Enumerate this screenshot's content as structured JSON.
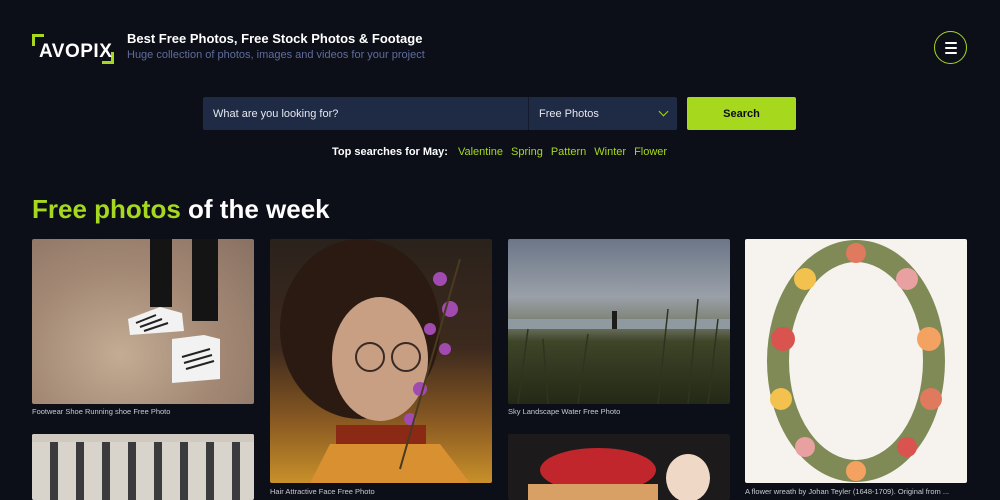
{
  "header": {
    "logo_text": "AVOPIX",
    "tagline": "Best Free Photos, Free Stock Photos & Footage",
    "subtagline": "Huge collection of photos, images and videos for your project"
  },
  "search": {
    "placeholder": "What are you looking for?",
    "type_selected": "Free Photos",
    "button_label": "Search"
  },
  "top_searches": {
    "label": "Top searches for May:",
    "tags": [
      "Valentine",
      "Spring",
      "Pattern",
      "Winter",
      "Flower"
    ]
  },
  "section": {
    "title_accent": "Free photos",
    "title_rest": " of the week"
  },
  "photos": [
    {
      "caption": "Footwear Shoe Running shoe Free Photo"
    },
    {
      "caption": "Hair Attractive Face Free Photo"
    },
    {
      "caption": "Sky Landscape Water Free Photo"
    },
    {
      "caption": "A flower wreath by Johan Teyler (1648-1709). Original from ..."
    },
    {
      "caption": ""
    },
    {
      "caption": ""
    }
  ],
  "colors": {
    "background": "#0c0e18",
    "accent": "#a6d81e",
    "search_bg": "#1f2a45",
    "subtle_text": "#5f6d9c"
  },
  "icons": {
    "menu": "hamburger-menu-icon",
    "dropdown": "chevron-down-icon"
  }
}
